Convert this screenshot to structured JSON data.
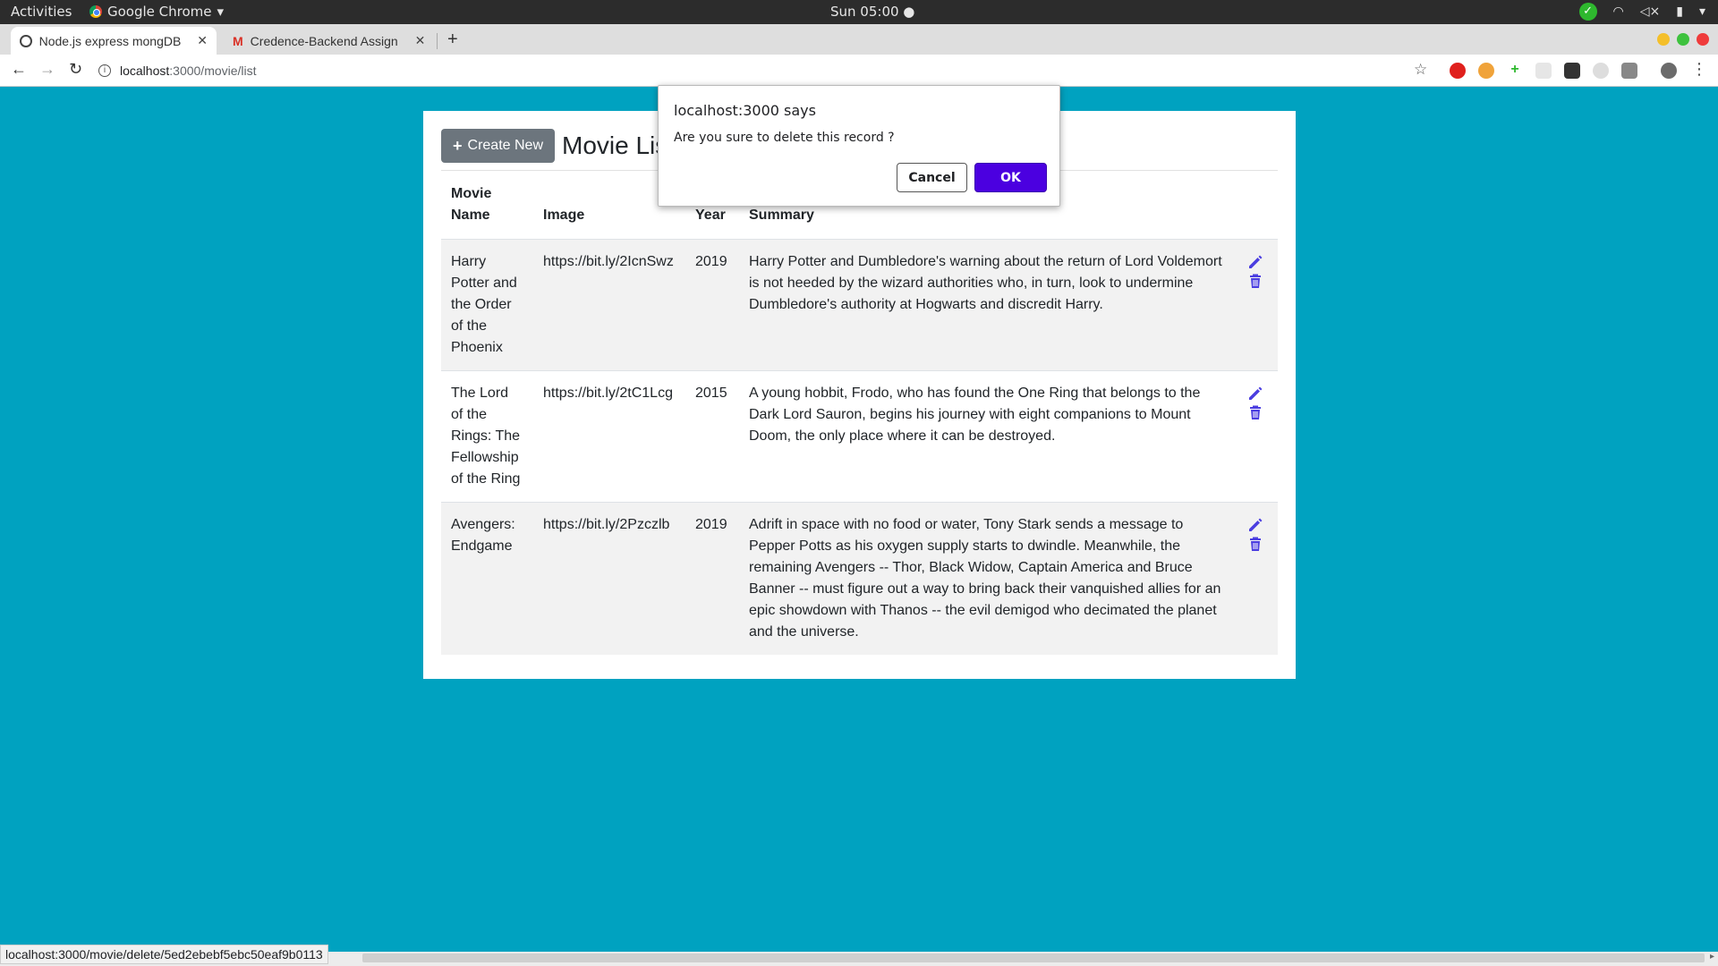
{
  "system_bar": {
    "activities": "Activities",
    "app_name": "Google Chrome",
    "clock": "Sun 05:00"
  },
  "tabs": [
    {
      "title": "Node.js express mongDB"
    },
    {
      "title": "Credence-Backend Assign"
    }
  ],
  "address_bar": {
    "host": "localhost",
    "path": ":3000/movie/list"
  },
  "page": {
    "create_button": "Create New",
    "title": "Movie List",
    "columns": {
      "name_line1": "Movie",
      "name_line2": "Name",
      "image": "Image",
      "year": "Year",
      "summary": "Summary"
    },
    "rows": [
      {
        "name": "Harry Potter and the Order of the Phoenix",
        "image": "https://bit.ly/2IcnSwz",
        "year": "2019",
        "summary": "Harry Potter and Dumbledore's warning about the return of Lord Voldemort is not heeded by the wizard authorities who, in turn, look to undermine Dumbledore's authority at Hogwarts and discredit Harry."
      },
      {
        "name": "The Lord of the Rings: The Fellowship of the Ring",
        "image": "https://bit.ly/2tC1Lcg",
        "year": "2015",
        "summary": "A young hobbit, Frodo, who has found the One Ring that belongs to the Dark Lord Sauron, begins his journey with eight companions to Mount Doom, the only place where it can be destroyed."
      },
      {
        "name": "Avengers: Endgame",
        "image": "https://bit.ly/2Pzczlb",
        "year": "2019",
        "summary": "Adrift in space with no food or water, Tony Stark sends a message to Pepper Potts as his oxygen supply starts to dwindle. Meanwhile, the remaining Avengers -- Thor, Black Widow, Captain America and Bruce Banner -- must figure out a way to bring back their vanquished allies for an epic showdown with Thanos -- the evil demigod who decimated the planet and the universe."
      }
    ]
  },
  "dialog": {
    "title": "localhost:3000 says",
    "message": "Are you sure to delete this record ?",
    "cancel": "Cancel",
    "ok": "OK"
  },
  "status_url": "localhost:3000/movie/delete/5ed2ebebf5ebc50eaf9b0113",
  "colors": {
    "page_background": "#00a2c0",
    "action_icon": "#4b3ee0",
    "ok_button": "#4b00e0",
    "create_button": "#6c757d"
  }
}
